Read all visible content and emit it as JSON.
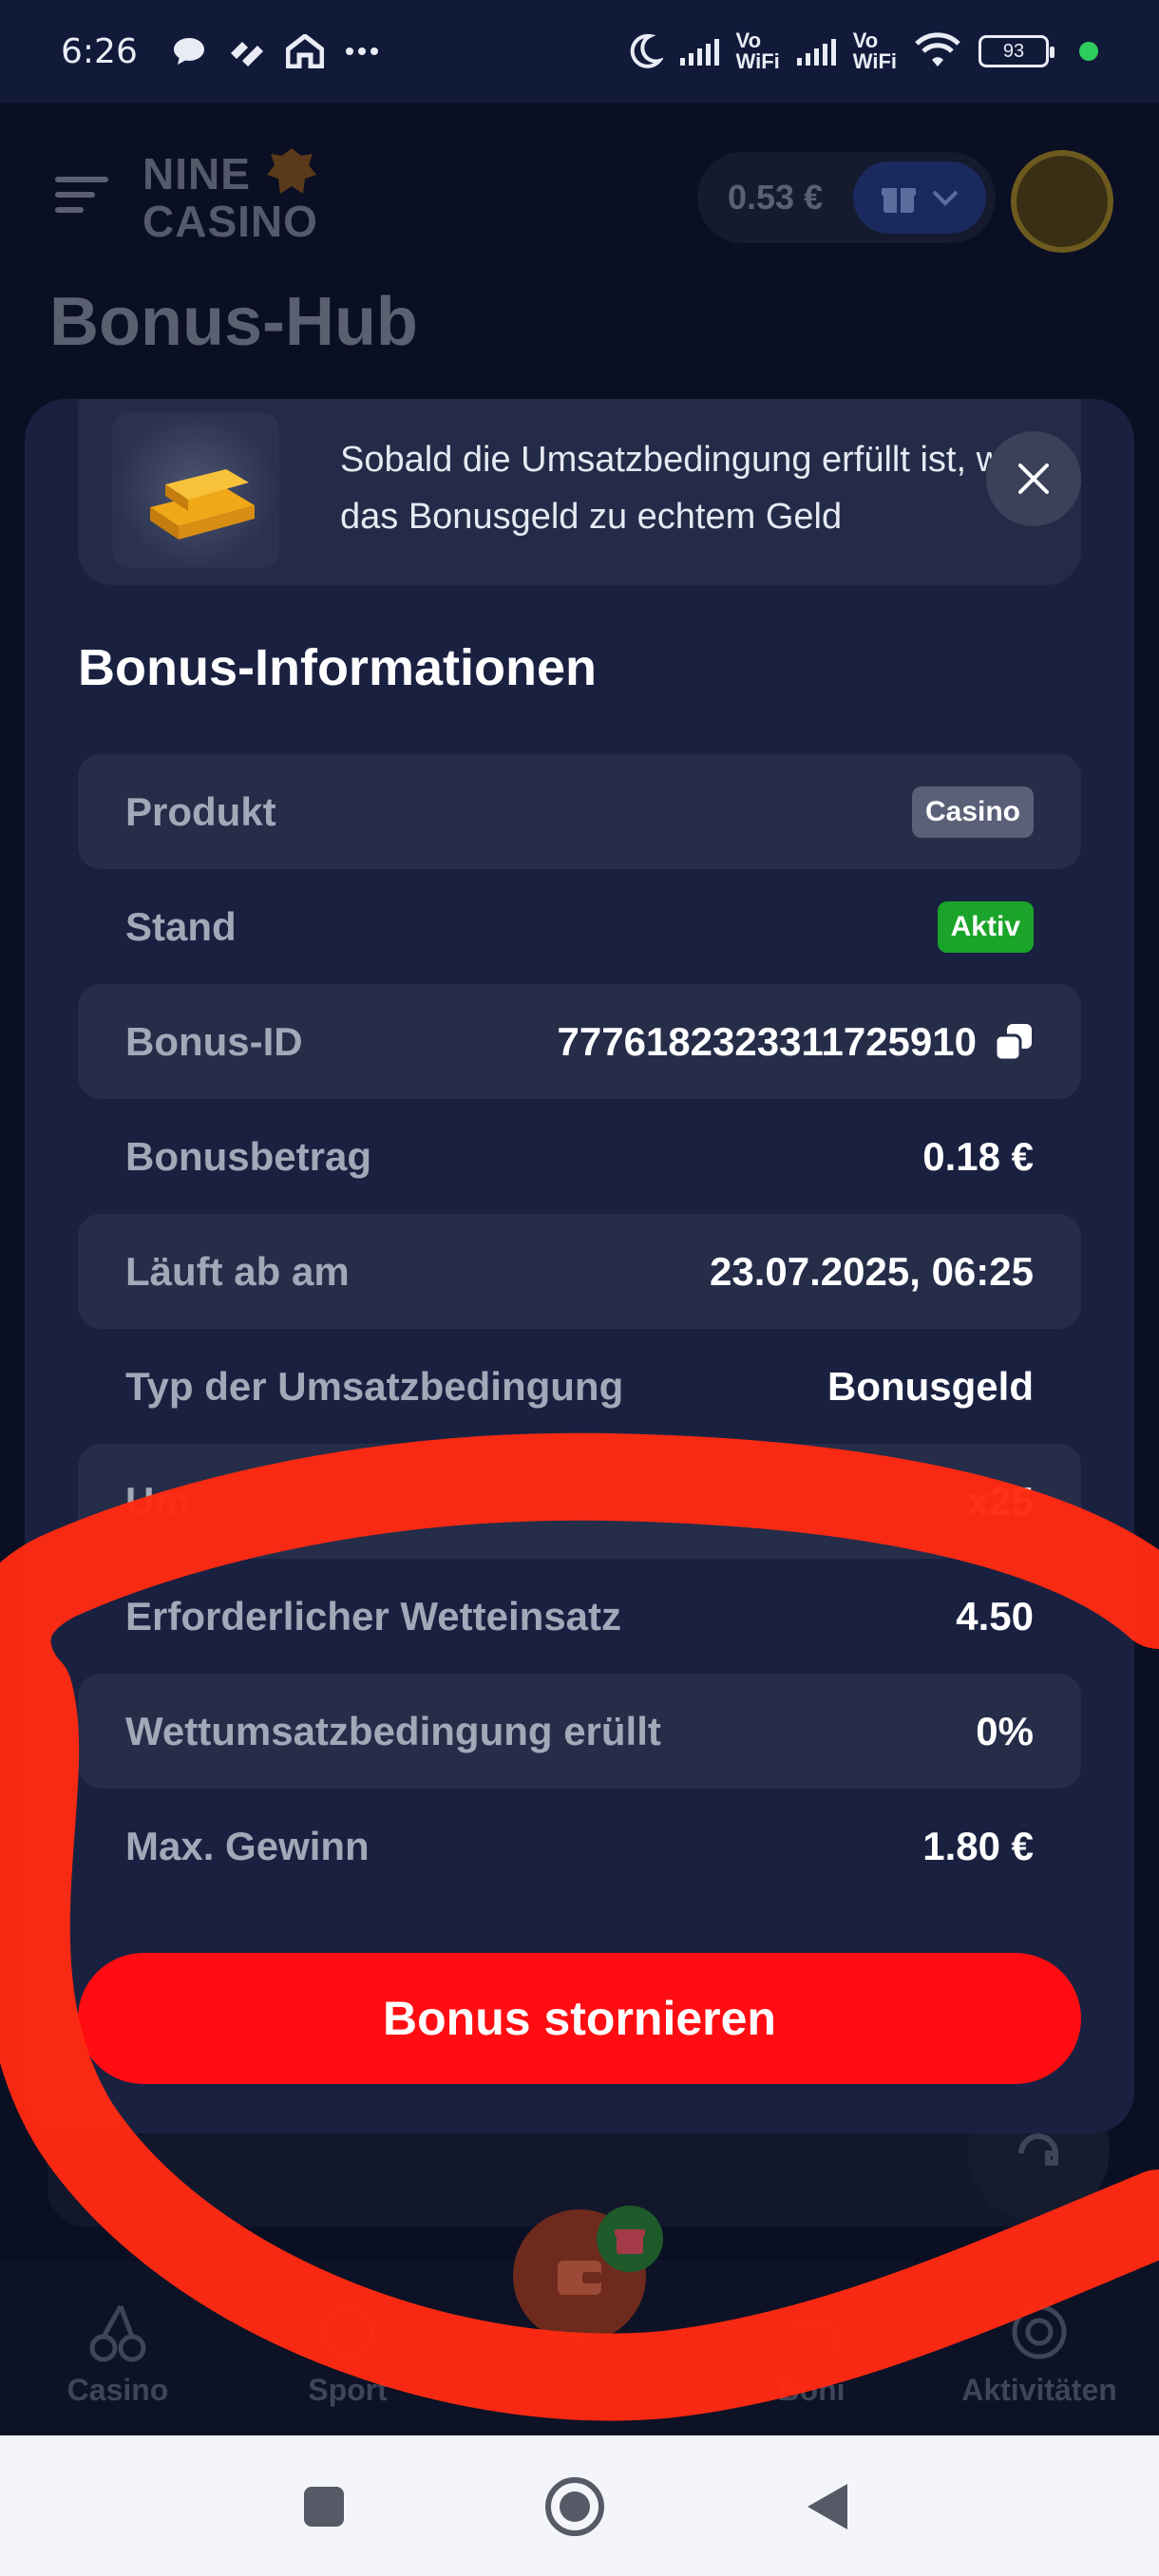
{
  "status_bar": {
    "time": "6:26",
    "vowifi_1": "Vo\nWiFi",
    "vowifi_2": "Vo\nWiFi",
    "battery": "93"
  },
  "header": {
    "logo_line1": "NINE",
    "logo_line2": "CASINO",
    "balance": "0.53 €",
    "page_title": "Bonus-Hub"
  },
  "modal": {
    "promo_text": "Sobald die Umsatzbedingung erfüllt ist, wird das Bonusgeld zu echtem Geld",
    "section_title": "Bonus-Informationen",
    "rows": [
      {
        "label": "Produkt",
        "value": "Casino"
      },
      {
        "label": "Stand",
        "value": "Aktiv"
      },
      {
        "label": "Bonus-ID",
        "value": "7776182323311725910"
      },
      {
        "label": "Bonusbetrag",
        "value": "0.18 €"
      },
      {
        "label": "Läuft ab am",
        "value": "23.07.2025, 06:25"
      },
      {
        "label": "Typ der Umsatzbedingung",
        "value": "Bonusgeld"
      },
      {
        "label": "Um",
        "value": "x25"
      },
      {
        "label": "Erforderlicher Wetteinsatz",
        "value": "4.50"
      },
      {
        "label": "Wettumsatzbedingung erüllt",
        "value": "0%"
      },
      {
        "label": "Max. Gewinn",
        "value": "1.80 €"
      }
    ],
    "cancel_label": "Bonus stornieren"
  },
  "bottom_nav": {
    "items": [
      {
        "label": "Casino"
      },
      {
        "label": "Sport"
      },
      {
        "label": "Boni"
      },
      {
        "label": "Aktivitäten"
      }
    ]
  },
  "colors": {
    "accent_red": "#ff0d13",
    "active_green": "#1aa52a",
    "annotation_red": "#ff2a12"
  }
}
